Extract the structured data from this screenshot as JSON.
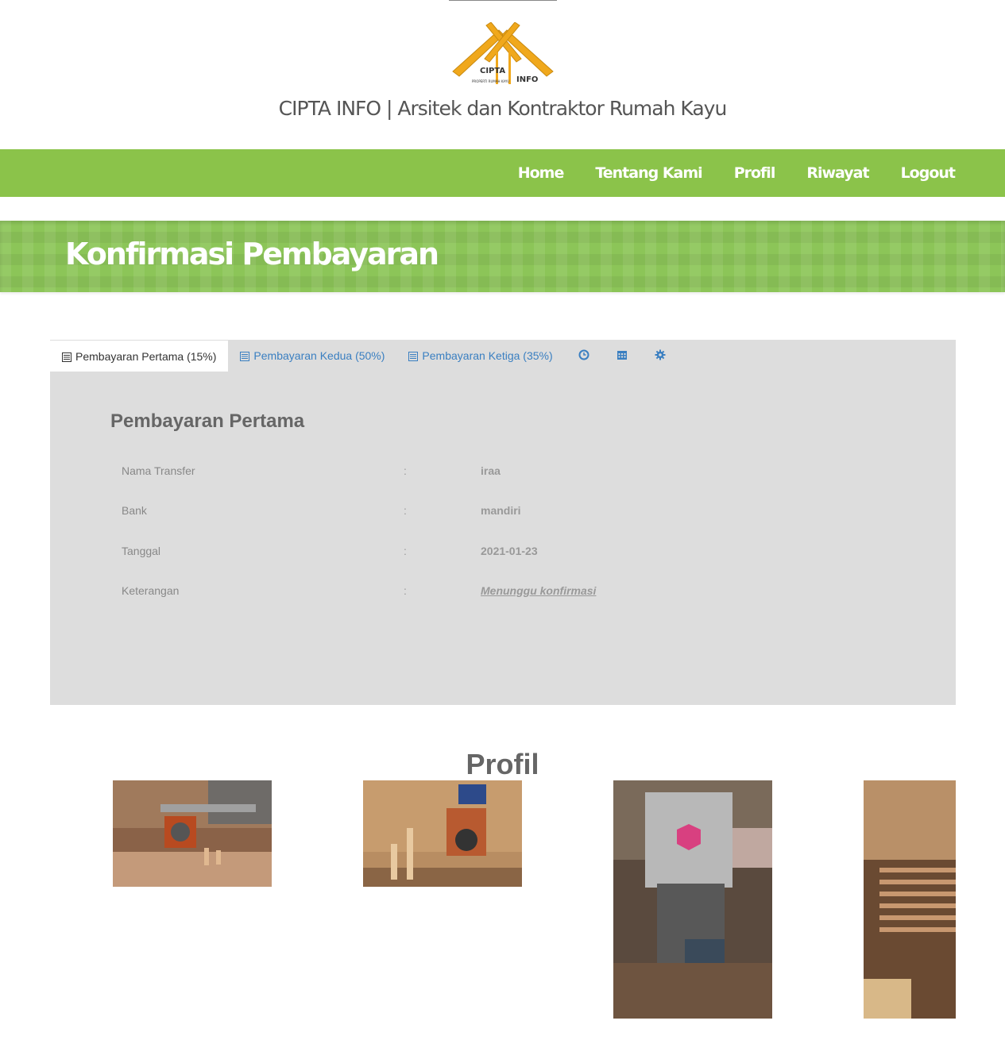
{
  "header": {
    "logo_text": "CIPTA INFO",
    "logo_subtext": "PROPERTI RUMAH KAYU",
    "site_title": "CIPTA INFO | Arsitek dan Kontraktor Rumah Kayu"
  },
  "nav": {
    "items": [
      {
        "label": "Home"
      },
      {
        "label": "Tentang Kami"
      },
      {
        "label": "Profil"
      },
      {
        "label": "Riwayat"
      },
      {
        "label": "Logout"
      }
    ],
    "bg_color": "#8bc34a"
  },
  "banner": {
    "title": "Konfirmasi Pembayaran"
  },
  "tabs": [
    {
      "label": "Pembayaran Pertama (15%)",
      "icon": "list-icon",
      "active": true
    },
    {
      "label": "Pembayaran Kedua (50%)",
      "icon": "list-icon",
      "active": false
    },
    {
      "label": "Pembayaran Ketiga (35%)",
      "icon": "list-icon",
      "active": false
    },
    {
      "label": "",
      "icon": "clock-icon",
      "active": false
    },
    {
      "label": "",
      "icon": "calendar-icon",
      "active": false
    },
    {
      "label": "",
      "icon": "gear-icon",
      "active": false
    }
  ],
  "payment": {
    "heading": "Pembayaran Pertama",
    "rows": [
      {
        "label": "Nama Transfer",
        "sep": ":",
        "value": "iraa"
      },
      {
        "label": "Bank",
        "sep": ":",
        "value": "mandiri"
      },
      {
        "label": "Tanggal",
        "sep": ":",
        "value": "2021-01-23"
      },
      {
        "label": "Keterangan",
        "sep": ":",
        "value": "Menunggu konfirmasi"
      }
    ]
  },
  "profil": {
    "title": "Profil",
    "photos": [
      "radial-arm-saw-photo",
      "wood-machine-photo",
      "band-saw-photo",
      "wood-stack-photo"
    ]
  }
}
